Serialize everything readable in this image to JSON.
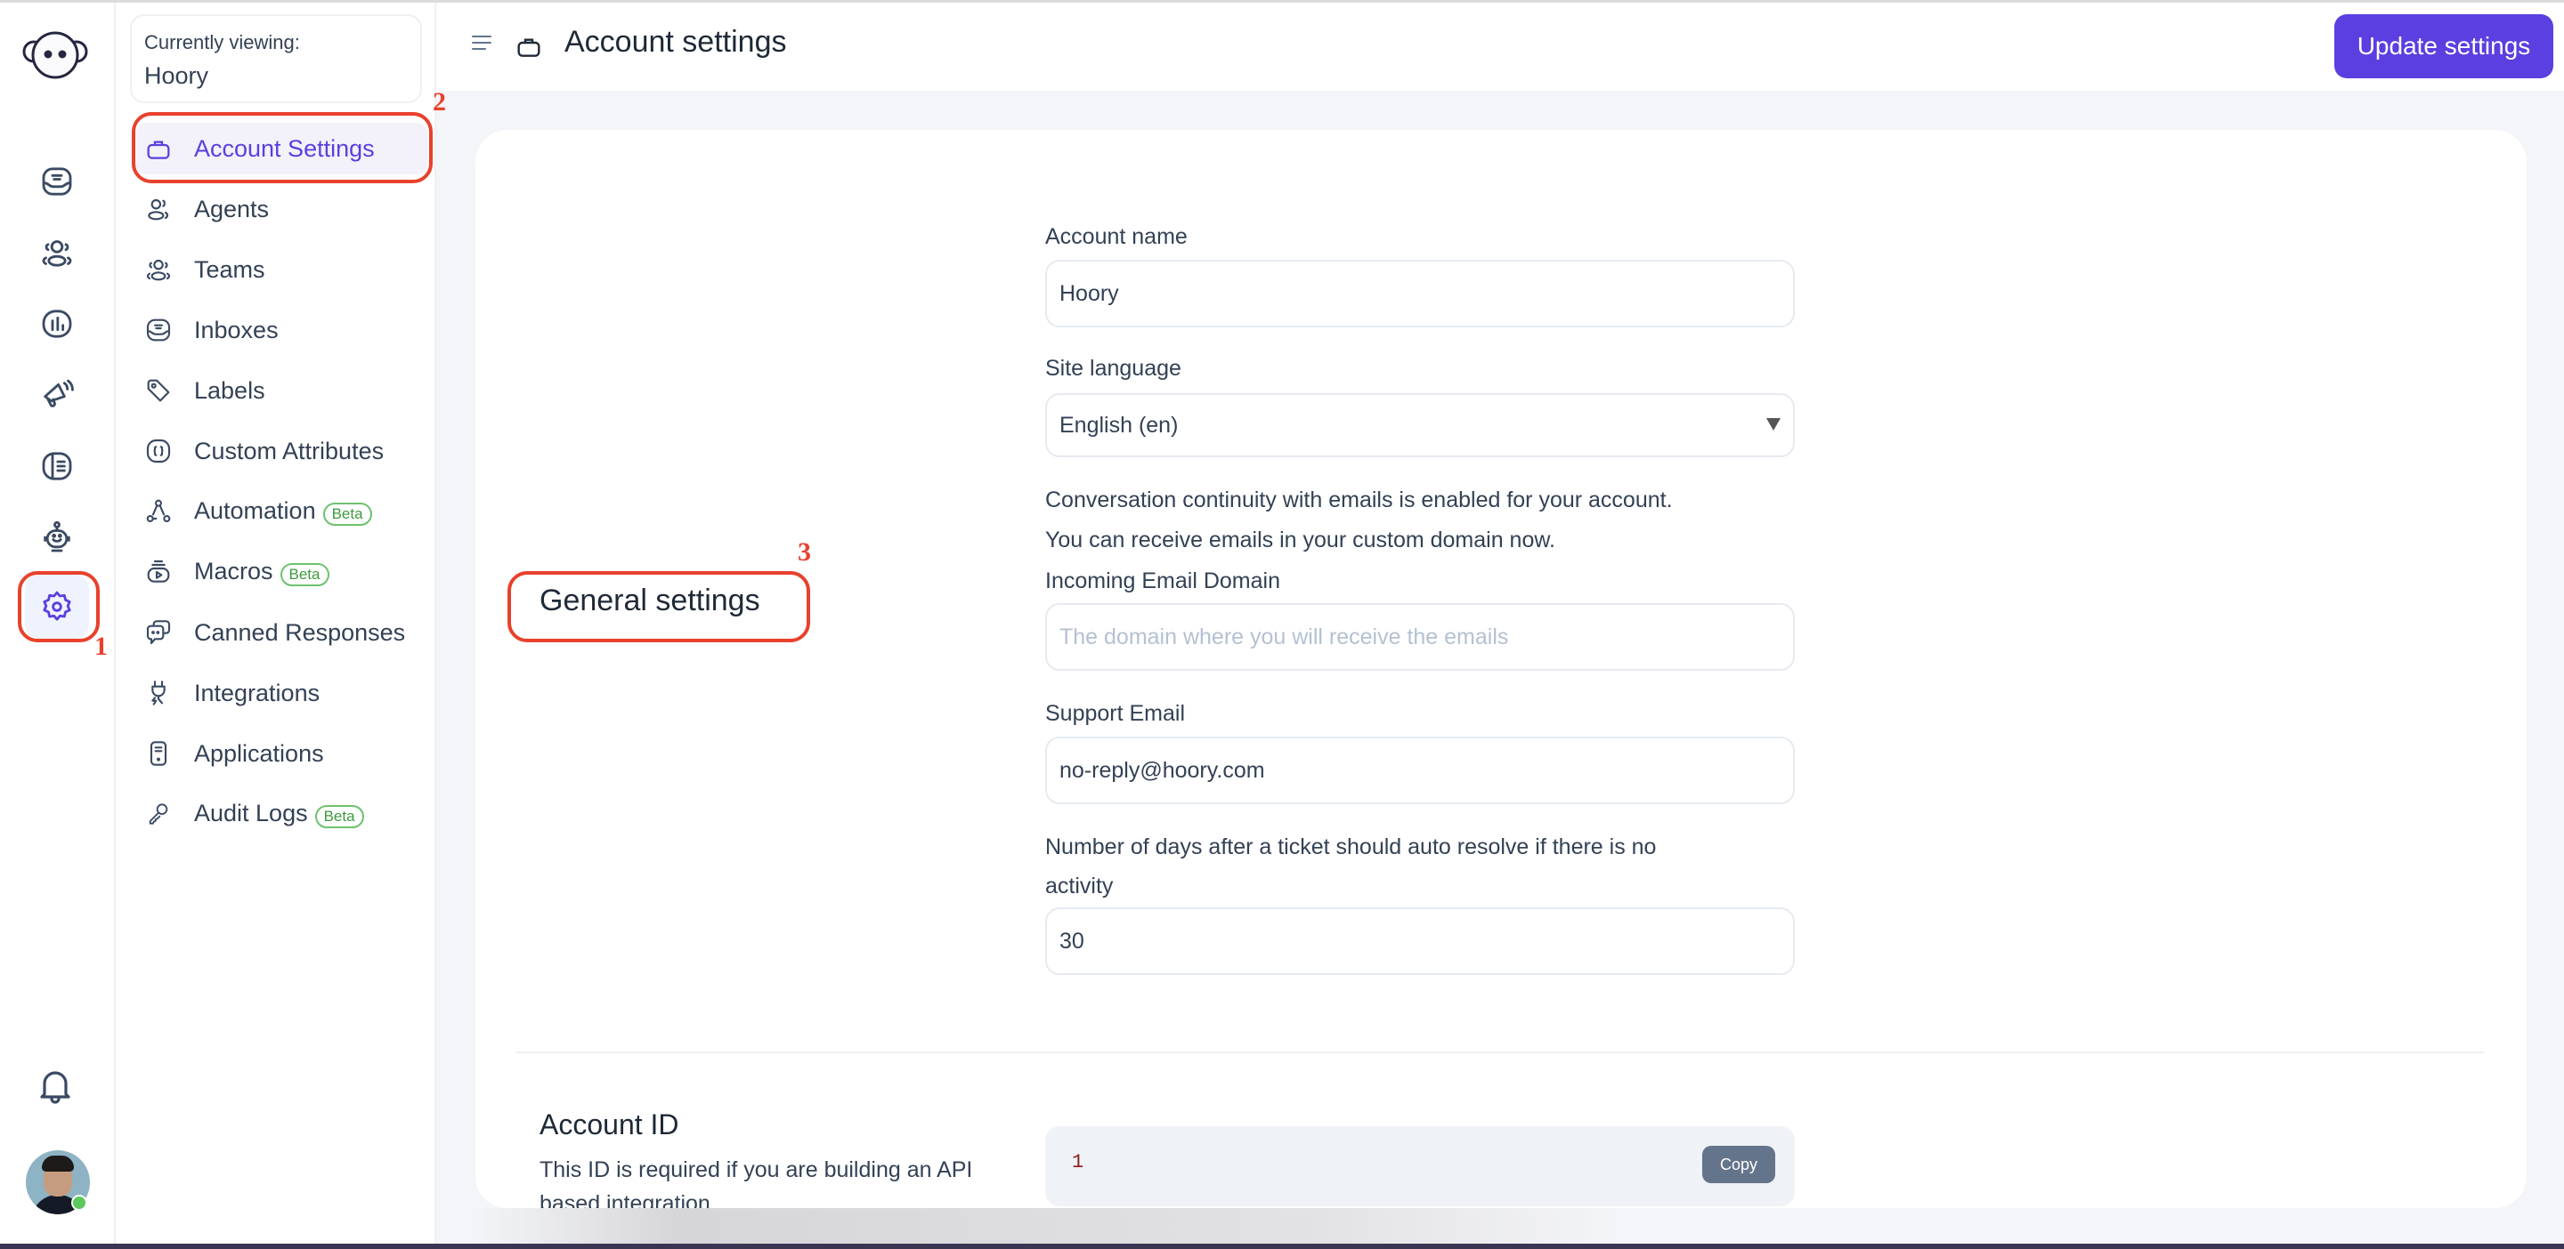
{
  "app": {
    "brand_color": "#5b3fe0",
    "annotation_color": "#e8412c"
  },
  "primary_nav": {
    "logo_icon": "monkey-logo-icon",
    "items": [
      {
        "name": "conversations",
        "icon": "inbox-icon",
        "active": false
      },
      {
        "name": "contacts",
        "icon": "contacts-icon",
        "active": false
      },
      {
        "name": "reports",
        "icon": "reports-icon",
        "active": false
      },
      {
        "name": "campaigns",
        "icon": "megaphone-icon",
        "active": false
      },
      {
        "name": "help-center",
        "icon": "library-icon",
        "active": false
      },
      {
        "name": "bot",
        "icon": "bot-icon",
        "active": false
      },
      {
        "name": "settings",
        "icon": "gear-icon",
        "active": true
      }
    ],
    "notifications_icon": "bell-icon",
    "user_status": "online"
  },
  "secondary_nav": {
    "currently_viewing_label": "Currently viewing:",
    "account_name": "Hoory",
    "items": [
      {
        "label": "Account Settings",
        "icon": "briefcase-icon",
        "active": true,
        "badge": null
      },
      {
        "label": "Agents",
        "icon": "agents-icon",
        "active": false,
        "badge": null
      },
      {
        "label": "Teams",
        "icon": "teams-icon",
        "active": false,
        "badge": null
      },
      {
        "label": "Inboxes",
        "icon": "inbox-icon",
        "active": false,
        "badge": null
      },
      {
        "label": "Labels",
        "icon": "tag-icon",
        "active": false,
        "badge": null
      },
      {
        "label": "Custom Attributes",
        "icon": "braces-icon",
        "active": false,
        "badge": null
      },
      {
        "label": "Automation",
        "icon": "automation-icon",
        "active": false,
        "badge": "Beta"
      },
      {
        "label": "Macros",
        "icon": "macros-icon",
        "active": false,
        "badge": "Beta"
      },
      {
        "label": "Canned Responses",
        "icon": "chat-bubbles-icon",
        "active": false,
        "badge": null
      },
      {
        "label": "Integrations",
        "icon": "plug-icon",
        "active": false,
        "badge": null
      },
      {
        "label": "Applications",
        "icon": "device-icon",
        "active": false,
        "badge": null
      },
      {
        "label": "Audit Logs",
        "icon": "key-icon",
        "active": false,
        "badge": "Beta"
      }
    ]
  },
  "header": {
    "title": "Account settings",
    "update_button": "Update settings"
  },
  "general_settings": {
    "heading": "General settings",
    "account_name_label": "Account name",
    "account_name_value": "Hoory",
    "site_language_label": "Site language",
    "site_language_value": "English (en)",
    "continuity_line1": "Conversation continuity with emails is enabled for your account.",
    "continuity_line2": "You can receive emails in your custom domain now.",
    "incoming_domain_label": "Incoming Email Domain",
    "incoming_domain_value": "",
    "incoming_domain_placeholder": "The domain where you will receive the emails",
    "support_email_label": "Support Email",
    "support_email_value": "no-reply@hoory.com",
    "auto_resolve_label_line1": "Number of days after a ticket should auto resolve if there is no",
    "auto_resolve_label_line2": "activity",
    "auto_resolve_value": "30"
  },
  "account_id": {
    "heading": "Account ID",
    "description": "This ID is required if you are building an API based integration",
    "value": "1",
    "copy_button": "Copy"
  },
  "annotations": [
    "1",
    "2",
    "3"
  ]
}
